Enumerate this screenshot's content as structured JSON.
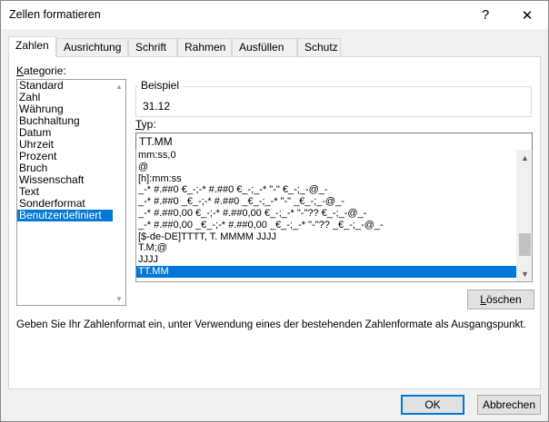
{
  "window": {
    "title": "Zellen formatieren",
    "help_glyph": "?",
    "close_glyph": "✕"
  },
  "tabs": [
    {
      "label": "Zahlen",
      "active": true
    },
    {
      "label": "Ausrichtung"
    },
    {
      "label": "Schrift"
    },
    {
      "label": "Rahmen"
    },
    {
      "label": "Ausfüllen"
    },
    {
      "label": "Schutz"
    }
  ],
  "category": {
    "label": "Kategorie:",
    "items": [
      "Standard",
      "Zahl",
      "Währung",
      "Buchhaltung",
      "Datum",
      "Uhrzeit",
      "Prozent",
      "Bruch",
      "Wissenschaft",
      "Text",
      "Sonderformat",
      "Benutzerdefiniert"
    ],
    "selected_index": 11
  },
  "example": {
    "label": "Beispiel",
    "value": "31.12"
  },
  "type": {
    "label": "Typ:",
    "value": "TT.MM"
  },
  "formats": {
    "items": [
      "mm:ss,0",
      "@",
      "[h]:mm:ss",
      "_-* #.##0 €_-;-* #.##0 €_-;_-* \"-\" €_-;_-@_-",
      "_-* #.##0 _€_-;-* #.##0 _€_-;_-* \"-\" _€_-;_-@_-",
      "_-* #.##0,00 €_-;-* #.##0,00 €_-;_-* \"-\"?? €_-;_-@_-",
      "_-* #.##0,00 _€_-;-* #.##0,00 _€_-;_-* \"-\"?? _€_-;_-@_-",
      "[$-de-DE]TTTT, T. MMMM JJJJ",
      "T.M;@",
      "JJJJ",
      "TT.MM"
    ],
    "selected_index": 10
  },
  "buttons": {
    "delete": "Löschen",
    "ok": "OK",
    "cancel": "Abbrechen"
  },
  "hint": "Geben Sie Ihr Zahlenformat ein, unter Verwendung eines der bestehenden Zahlenformate als Ausgangspunkt.",
  "colors": {
    "selection": "#0078d7",
    "dialog_bg": "#f0f0f0"
  }
}
